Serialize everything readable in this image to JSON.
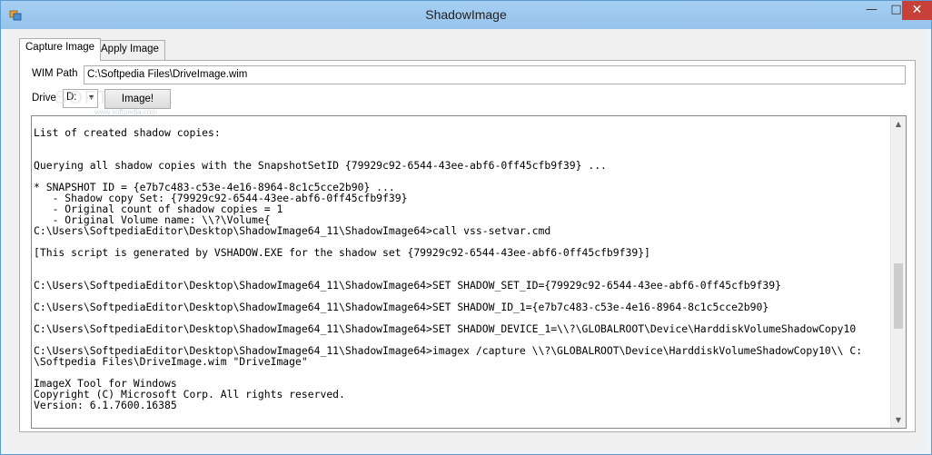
{
  "window": {
    "title": "ShadowImage",
    "minimize_glyph": "—",
    "maximize_glyph": "□",
    "close_glyph": "✕",
    "icon": "app-icon"
  },
  "tabs": [
    {
      "label": "Capture Image",
      "active": true
    },
    {
      "label": "Apply Image",
      "active": false
    }
  ],
  "capture": {
    "wim_path_label": "WIM Path",
    "wim_path_value": "C:\\Softpedia Files\\DriveImage.wim",
    "drive_label": "Drive",
    "drive_value": "D:",
    "image_button_label": "Image!"
  },
  "watermark": {
    "text": "SOFTPEDIA",
    "sub": "www.softpedia.com"
  },
  "output": {
    "text": "List of created shadow copies:\n\n\nQuerying all shadow copies with the SnapshotSetID {79929c92-6544-43ee-abf6-0ff45cfb9f39} ...\n\n* SNAPSHOT ID = {e7b7c483-c53e-4e16-8964-8c1c5cce2b90} ...\n   - Shadow copy Set: {79929c92-6544-43ee-abf6-0ff45cfb9f39}\n   - Original count of shadow copies = 1\n   - Original Volume name: \\\\?\\Volume{\nC:\\Users\\SoftpediaEditor\\Desktop\\ShadowImage64_11\\ShadowImage64>call vss-setvar.cmd\n\n[This script is generated by VSHADOW.EXE for the shadow set {79929c92-6544-43ee-abf6-0ff45cfb9f39}]\n\n\nC:\\Users\\SoftpediaEditor\\Desktop\\ShadowImage64_11\\ShadowImage64>SET SHADOW_SET_ID={79929c92-6544-43ee-abf6-0ff45cfb9f39}\n\nC:\\Users\\SoftpediaEditor\\Desktop\\ShadowImage64_11\\ShadowImage64>SET SHADOW_ID_1={e7b7c483-c53e-4e16-8964-8c1c5cce2b90}\n\nC:\\Users\\SoftpediaEditor\\Desktop\\ShadowImage64_11\\ShadowImage64>SET SHADOW_DEVICE_1=\\\\?\\GLOBALROOT\\Device\\HarddiskVolumeShadowCopy10\n\nC:\\Users\\SoftpediaEditor\\Desktop\\ShadowImage64_11\\ShadowImage64>imagex /capture \\\\?\\GLOBALROOT\\Device\\HarddiskVolumeShadowCopy10\\\\ C:\n\\Softpedia Files\\DriveImage.wim \"DriveImage\"\n\nImageX Tool for Windows\nCopyright (C) Microsoft Corp. All rights reserved.\nVersion: 6.1.7600.16385"
  },
  "scrollbar": {
    "up_glyph": "▲",
    "down_glyph": "▼"
  },
  "colors": {
    "titlebar": "#9fcaf0",
    "close_button": "#c7403a",
    "window_border": "#5b9bd5"
  }
}
